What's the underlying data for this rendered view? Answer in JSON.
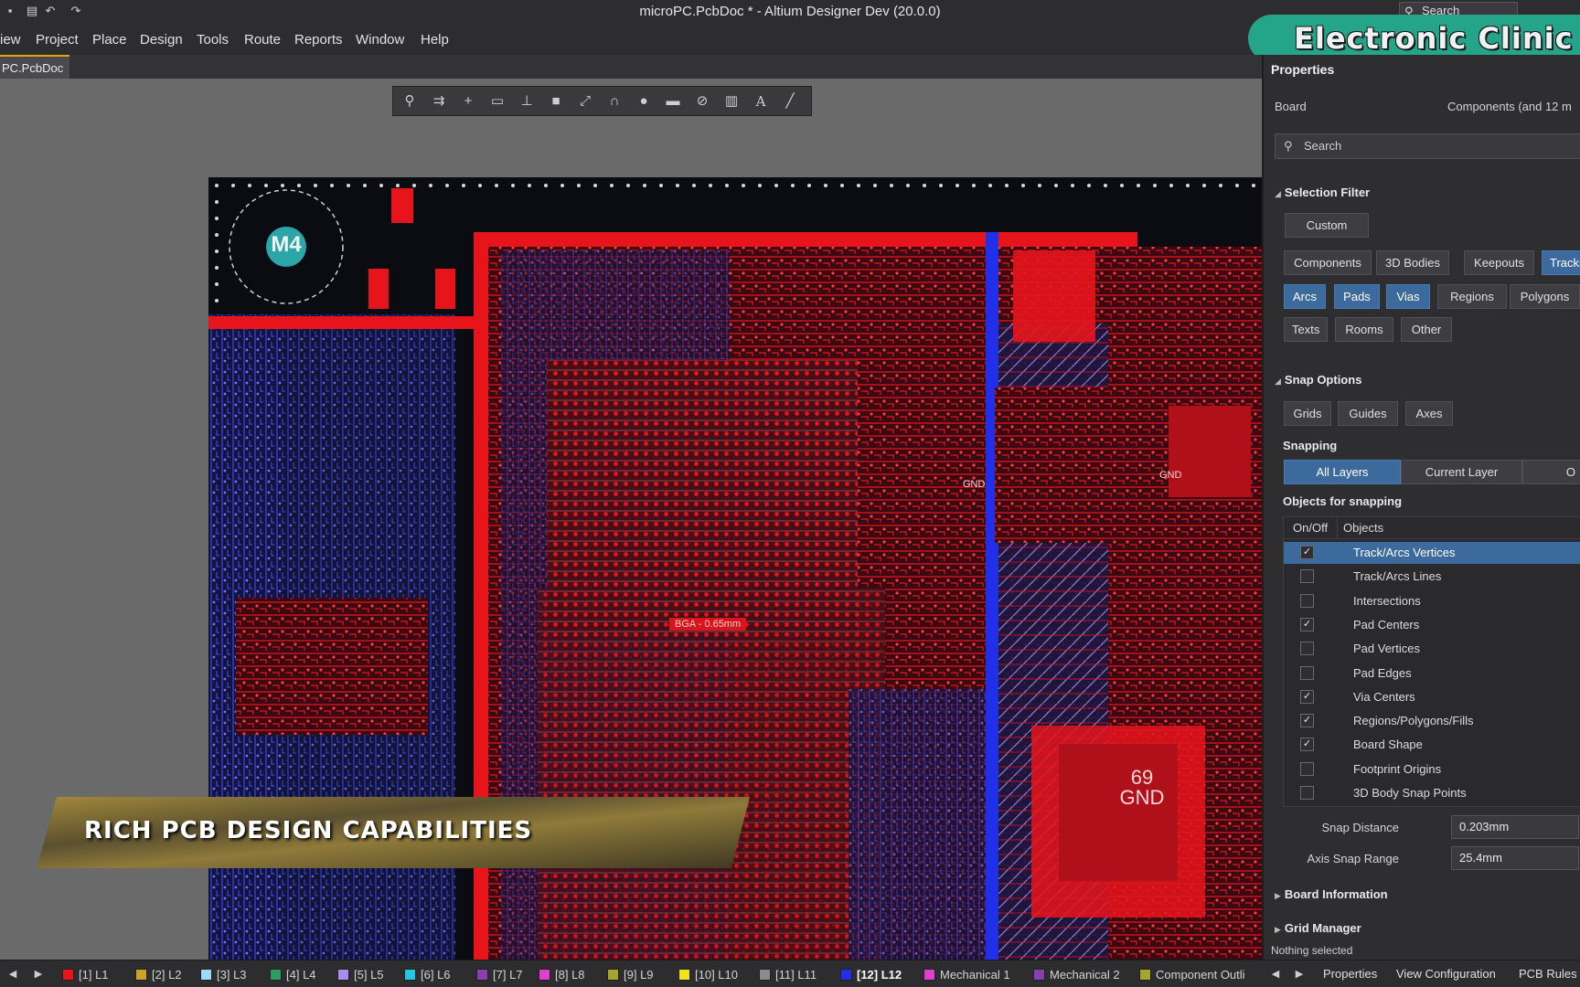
{
  "titlebar": {
    "title": "microPC.PcbDoc * - Altium Designer Dev (20.0.0)",
    "search_label": "Search",
    "quick_access": [
      "save-icon",
      "open-icon",
      "undo-icon",
      "redo-icon"
    ]
  },
  "brand": {
    "text": "Electronic Clinic"
  },
  "menu": [
    "iew",
    "Project",
    "Place",
    "Design",
    "Tools",
    "Route",
    "Reports",
    "Window",
    "Help"
  ],
  "document_tab": "PC.PcbDoc *",
  "toolbar_icons": [
    "filter-icon",
    "route-icon",
    "crosshair-icon",
    "select-rect-icon",
    "component-icon",
    "fill-icon",
    "track-icon",
    "net-icon",
    "pin-icon",
    "region-icon",
    "keepout-icon",
    "dimension-icon",
    "text-icon",
    "line-icon"
  ],
  "board": {
    "mount_hole_label": "M4",
    "bga_label": "BGA - 0.65mm",
    "gnd_labels": [
      {
        "line1": "69",
        "line2": "GND"
      },
      {
        "line1": "",
        "line2": "GND"
      },
      {
        "line1": "",
        "line2": "GND"
      }
    ]
  },
  "banner": {
    "text": "RICH PCB DESIGN CAPABILITIES"
  },
  "properties": {
    "title": "Properties",
    "scope_left": "Board",
    "scope_right": "Components (and 12 m",
    "search_placeholder": "Search",
    "selection_filter": {
      "heading": "Selection Filter",
      "custom_label": "Custom",
      "chips": [
        {
          "label": "Components",
          "on": false
        },
        {
          "label": "3D Bodies",
          "on": false
        },
        {
          "label": "Keepouts",
          "on": false
        },
        {
          "label": "Tracks",
          "on": true
        },
        {
          "label": "Arcs",
          "on": true
        },
        {
          "label": "Pads",
          "on": true
        },
        {
          "label": "Vias",
          "on": true
        },
        {
          "label": "Regions",
          "on": false
        },
        {
          "label": "Polygons",
          "on": false
        },
        {
          "label": "Texts",
          "on": false
        },
        {
          "label": "Rooms",
          "on": false
        },
        {
          "label": "Other",
          "on": false
        }
      ]
    },
    "snap_options": {
      "heading": "Snap Options",
      "chips": [
        "Grids",
        "Guides",
        "Axes"
      ],
      "snapping_label": "Snapping",
      "snapping_modes": [
        "All Layers",
        "Current Layer",
        "O"
      ],
      "snapping_active": "All Layers",
      "objects_heading": "Objects for snapping",
      "col_onoff": "On/Off",
      "col_objects": "Objects",
      "rows": [
        {
          "label": "Track/Arcs Vertices",
          "checked": true,
          "selected": true
        },
        {
          "label": "Track/Arcs Lines",
          "checked": false,
          "selected": false
        },
        {
          "label": "Intersections",
          "checked": false,
          "selected": false
        },
        {
          "label": "Pad Centers",
          "checked": true,
          "selected": false
        },
        {
          "label": "Pad Vertices",
          "checked": false,
          "selected": false
        },
        {
          "label": "Pad Edges",
          "checked": false,
          "selected": false
        },
        {
          "label": "Via Centers",
          "checked": true,
          "selected": false
        },
        {
          "label": "Regions/Polygons/Fills",
          "checked": true,
          "selected": false
        },
        {
          "label": "Board Shape",
          "checked": true,
          "selected": false
        },
        {
          "label": "Footprint Origins",
          "checked": false,
          "selected": false
        },
        {
          "label": "3D Body Snap Points",
          "checked": false,
          "selected": false
        }
      ],
      "snap_distance_label": "Snap Distance",
      "snap_distance_value": "0.203mm",
      "axis_snap_label": "Axis Snap Range",
      "axis_snap_value": "25.4mm"
    },
    "board_information": "Board Information",
    "grid_manager": "Grid Manager",
    "footer": "Nothing selected"
  },
  "statusbar": {
    "layers": [
      {
        "label": "[1] L1",
        "color": "#e8141c"
      },
      {
        "label": "[2] L2",
        "color": "#c9a227"
      },
      {
        "label": "[3] L3",
        "color": "#9fd8ff"
      },
      {
        "label": "[4] L4",
        "color": "#2e9b5f"
      },
      {
        "label": "[5] L5",
        "color": "#a98cf0"
      },
      {
        "label": "[6] L6",
        "color": "#22c7e0"
      },
      {
        "label": "[7] L7",
        "color": "#8a3fb0"
      },
      {
        "label": "[8] L8",
        "color": "#e23fd0"
      },
      {
        "label": "[9] L9",
        "color": "#a6a62a"
      },
      {
        "label": "[10] L10",
        "color": "#f2e21a"
      },
      {
        "label": "[11] L11",
        "color": "#8c8c8c"
      },
      {
        "label": "[12] L12",
        "color": "#2030e8"
      },
      {
        "label": "Mechanical 1",
        "color": "#e23fd0"
      },
      {
        "label": "Mechanical 2",
        "color": "#8a3fb0"
      },
      {
        "label": "Component Outli",
        "color": "#a6a62a"
      }
    ],
    "active_layer": "[12] L12",
    "bottom_tabs": [
      "Properties",
      "View Configuration",
      "PCB Rules"
    ]
  },
  "colors": {
    "top_copper": "#e8141c",
    "bottom_copper": "#2030e8",
    "accent": "#3d6a9c",
    "brand": "#24a58a"
  }
}
